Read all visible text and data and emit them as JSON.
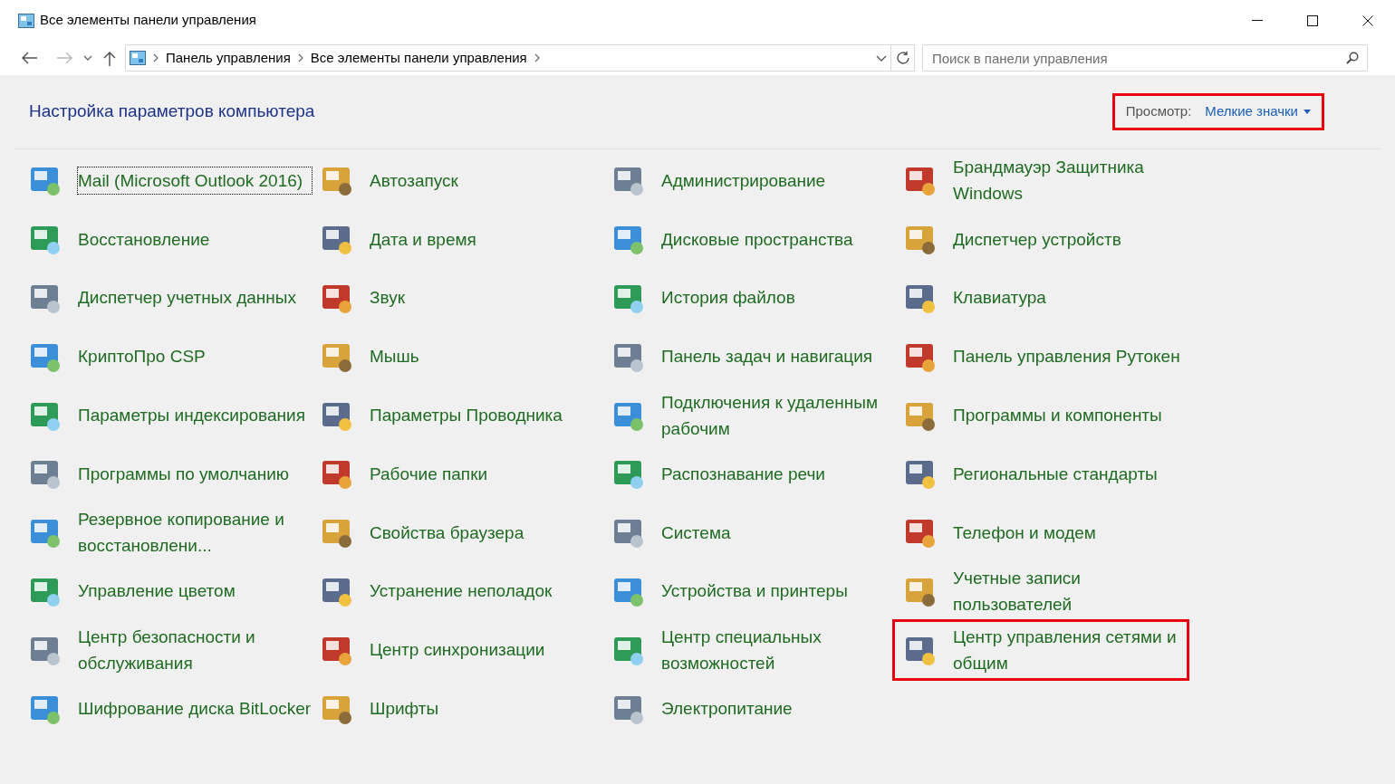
{
  "window": {
    "title": "Все элементы панели управления"
  },
  "address_bar": {
    "breadcrumbs": [
      "Панель управления",
      "Все элементы панели управления"
    ]
  },
  "search": {
    "placeholder": "Поиск в панели управления"
  },
  "header": {
    "title": "Настройка параметров компьютера",
    "view_label": "Просмотр:",
    "view_value": "Мелкие значки",
    "view_highlighted": true
  },
  "items": [
    {
      "label": "Mail (Microsoft Outlook 2016)",
      "focused": true,
      "highlighted": false
    },
    {
      "label": "Автозапуск",
      "focused": false,
      "highlighted": false
    },
    {
      "label": "Администрирование",
      "focused": false,
      "highlighted": false
    },
    {
      "label": "Брандмауэр Защитника Windows",
      "focused": false,
      "highlighted": false
    },
    {
      "label": "Восстановление",
      "focused": false,
      "highlighted": false
    },
    {
      "label": "Дата и время",
      "focused": false,
      "highlighted": false
    },
    {
      "label": "Дисковые пространства",
      "focused": false,
      "highlighted": false
    },
    {
      "label": "Диспетчер устройств",
      "focused": false,
      "highlighted": false
    },
    {
      "label": "Диспетчер учетных данных",
      "focused": false,
      "highlighted": false
    },
    {
      "label": "Звук",
      "focused": false,
      "highlighted": false
    },
    {
      "label": "История файлов",
      "focused": false,
      "highlighted": false
    },
    {
      "label": "Клавиатура",
      "focused": false,
      "highlighted": false
    },
    {
      "label": "КриптоПро CSP",
      "focused": false,
      "highlighted": false
    },
    {
      "label": "Мышь",
      "focused": false,
      "highlighted": false
    },
    {
      "label": "Панель задач и навигация",
      "focused": false,
      "highlighted": false
    },
    {
      "label": "Панель управления Рутокен",
      "focused": false,
      "highlighted": false
    },
    {
      "label": "Параметры индексирования",
      "focused": false,
      "highlighted": false
    },
    {
      "label": "Параметры Проводника",
      "focused": false,
      "highlighted": false
    },
    {
      "label": "Подключения к удаленным рабочим",
      "focused": false,
      "highlighted": false
    },
    {
      "label": "Программы и компоненты",
      "focused": false,
      "highlighted": false
    },
    {
      "label": "Программы по умолчанию",
      "focused": false,
      "highlighted": false
    },
    {
      "label": "Рабочие папки",
      "focused": false,
      "highlighted": false
    },
    {
      "label": "Распознавание речи",
      "focused": false,
      "highlighted": false
    },
    {
      "label": "Региональные стандарты",
      "focused": false,
      "highlighted": false
    },
    {
      "label": "Резервное копирование и восстановлени...",
      "focused": false,
      "highlighted": false
    },
    {
      "label": "Свойства браузера",
      "focused": false,
      "highlighted": false
    },
    {
      "label": "Система",
      "focused": false,
      "highlighted": false
    },
    {
      "label": "Телефон и модем",
      "focused": false,
      "highlighted": false
    },
    {
      "label": "Управление цветом",
      "focused": false,
      "highlighted": false
    },
    {
      "label": "Устранение неполадок",
      "focused": false,
      "highlighted": false
    },
    {
      "label": "Устройства и принтеры",
      "focused": false,
      "highlighted": false
    },
    {
      "label": "Учетные записи пользователей",
      "focused": false,
      "highlighted": false
    },
    {
      "label": "Центр безопасности и обслуживания",
      "focused": false,
      "highlighted": false
    },
    {
      "label": "Центр синхронизации",
      "focused": false,
      "highlighted": false
    },
    {
      "label": "Центр специальных возможностей",
      "focused": false,
      "highlighted": false
    },
    {
      "label": "Центр управления сетями и общим",
      "focused": false,
      "highlighted": true
    },
    {
      "label": "Шифрование диска BitLocker",
      "focused": false,
      "highlighted": false
    },
    {
      "label": "Шрифты",
      "focused": false,
      "highlighted": false
    },
    {
      "label": "Электропитание",
      "focused": false,
      "highlighted": false
    }
  ]
}
